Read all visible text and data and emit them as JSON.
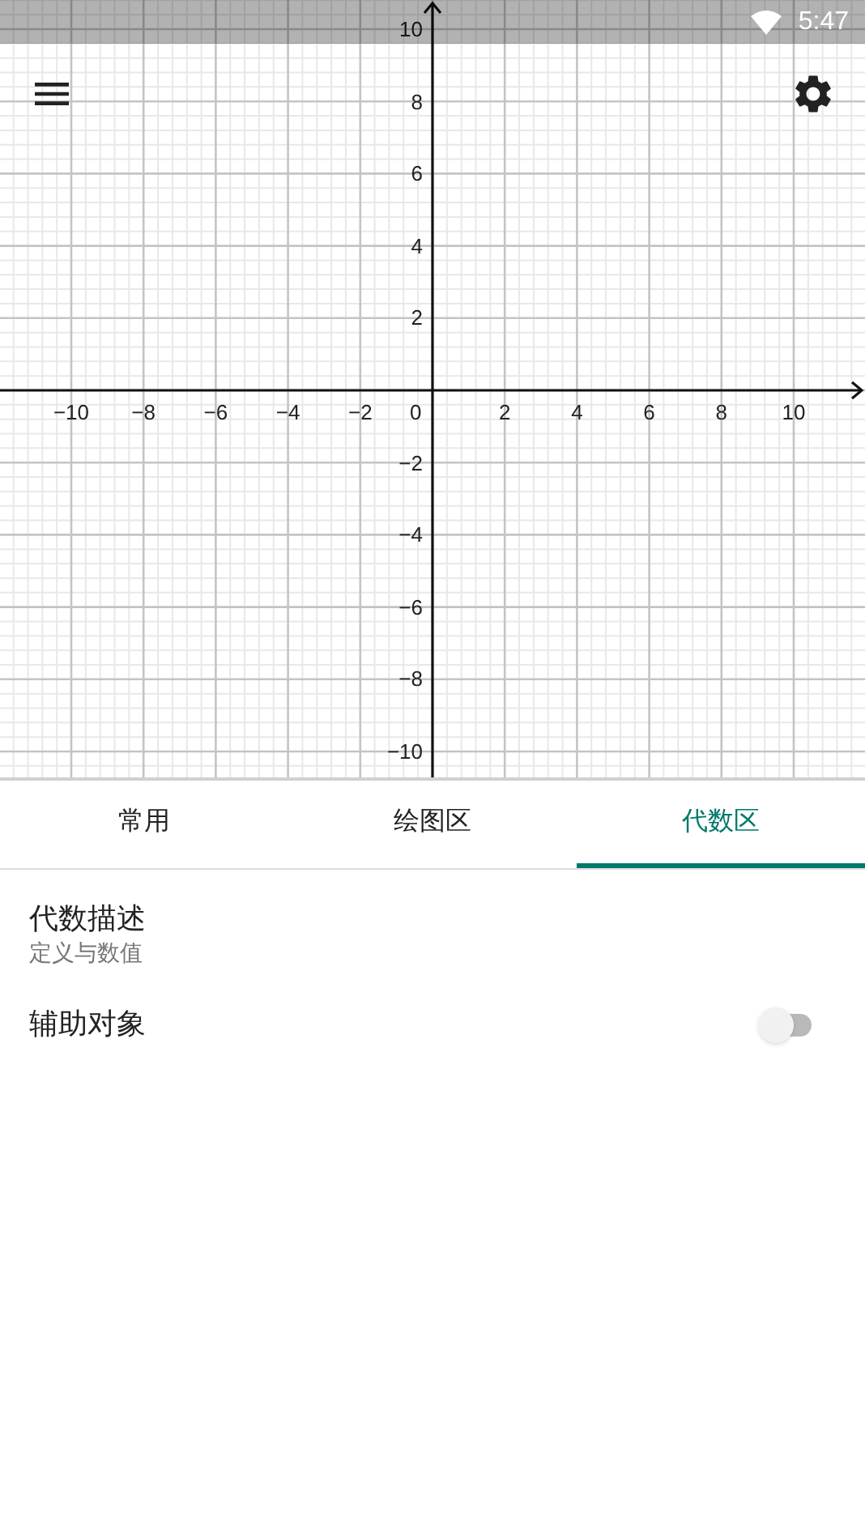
{
  "status_bar": {
    "time": "5:47"
  },
  "graph": {
    "x_tick_labels": [
      "−10",
      "−8",
      "−6",
      "−4",
      "−2",
      "2",
      "4",
      "6",
      "8",
      "10"
    ],
    "y_tick_labels": [
      "10",
      "8",
      "6",
      "4",
      "2",
      "−2",
      "−4",
      "−6",
      "−8",
      "−10"
    ],
    "origin_label": "0"
  },
  "tabs": [
    {
      "label": "常用",
      "selected": false
    },
    {
      "label": "绘图区",
      "selected": false
    },
    {
      "label": "代数区",
      "selected": true
    }
  ],
  "settings": [
    {
      "kind": "text",
      "title": "代数描述",
      "subtitle": "定义与数值"
    },
    {
      "kind": "toggle",
      "title": "辅助对象",
      "on": false
    }
  ]
}
